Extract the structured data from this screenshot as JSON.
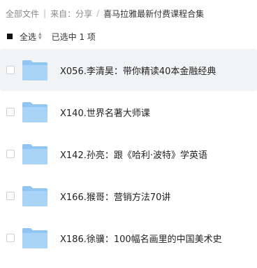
{
  "breadcrumb": {
    "all_files": "全部文件",
    "source": "来自：分享",
    "current": "喜马拉雅最新付费课程合集"
  },
  "selection": {
    "select_all_label": "全选",
    "selected_count_text": "已选中 1 项"
  },
  "files": [
    {
      "name": "X056.李清昊：带你精读40本金融经典",
      "icon": "folder-icon",
      "highlighted": true
    },
    {
      "name": "X140.世界名著大师课",
      "icon": "folder-icon"
    },
    {
      "name": "X142.孙亮：跟《哈利·波特》学英语",
      "icon": "folder-icon"
    },
    {
      "name": "X166.猴哥：营销方法70讲",
      "icon": "folder-icon"
    },
    {
      "name": "X186.徐骥：100幅名画里的中国美术史",
      "icon": "folder-icon"
    }
  ],
  "colors": {
    "folder_back": "#8fc6f2",
    "folder_front": "#a9d4f7",
    "row_highlight": "#f2f3f5"
  }
}
